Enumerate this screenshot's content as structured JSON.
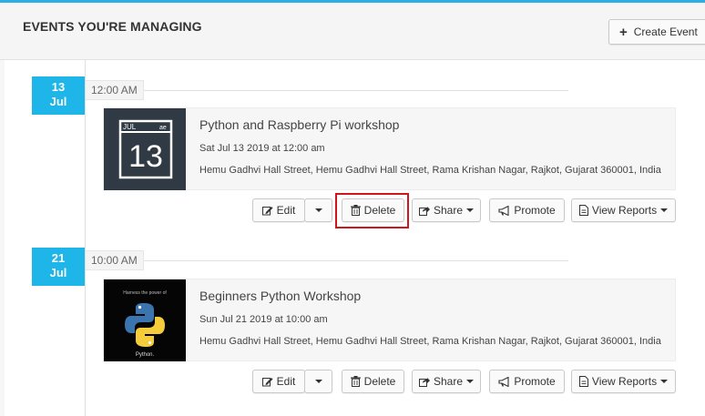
{
  "page": {
    "title": "EVENTS YOU'RE MANAGING",
    "create_label": "Create Event"
  },
  "colors": {
    "accent": "#1eb6e8",
    "highlight": "#d0161c"
  },
  "events": [
    {
      "day": "13",
      "month": "Jul",
      "time": "12:00 AM",
      "thumb_month": "JUL",
      "thumb_day": "13",
      "title": "Python and Raspberry Pi workshop",
      "datetime": "Sat Jul 13 2019 at 12:00 am",
      "address": "Hemu Gadhvi Hall Street, Hemu Gadhvi Hall Street, Rama Krishan Nagar, Rajkot, Gujarat 360001, India"
    },
    {
      "day": "21",
      "month": "Jul",
      "time": "10:00 AM",
      "thumb_tagline": "Harness the power of",
      "thumb_caption": "Python.",
      "title": "Beginners Python Workshop",
      "datetime": "Sun Jul 21 2019 at 10:00 am",
      "address": "Hemu Gadhvi Hall Street, Hemu Gadhvi Hall Street, Rama Krishan Nagar, Rajkot, Gujarat 360001, India"
    }
  ],
  "actions": {
    "edit": "Edit",
    "delete": "Delete",
    "share": "Share",
    "promote": "Promote",
    "view_reports": "View Reports"
  }
}
